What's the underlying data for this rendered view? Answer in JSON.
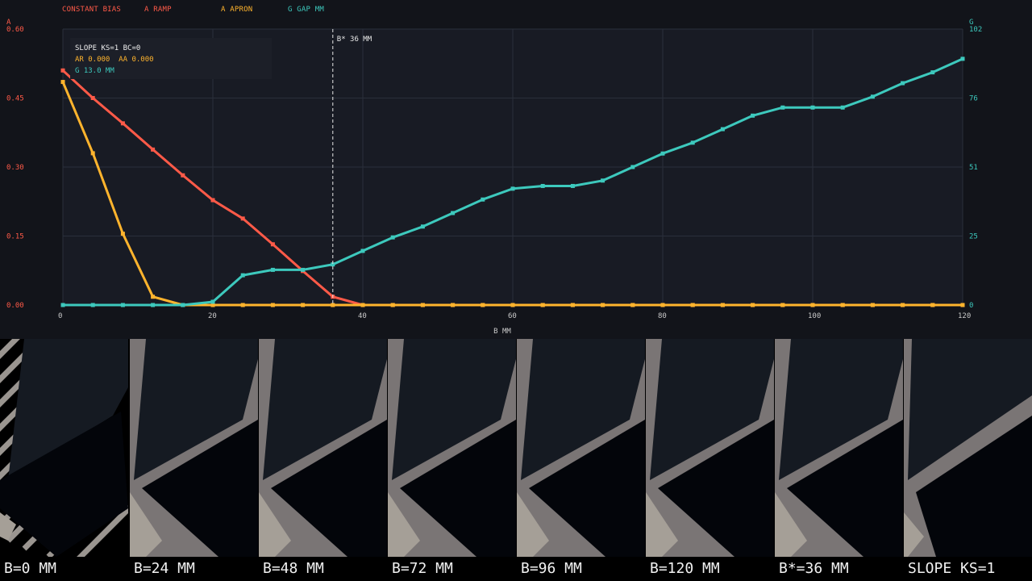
{
  "colors": {
    "background": "#12141a",
    "plot_background": "#181b24",
    "grid": "#2a2f3b",
    "constant_bias": "#ff5a48",
    "ramp": "#ffb42d",
    "apron": "#ffb42d",
    "gap": "#3dc9bd",
    "axis_text": "#c9c9c9"
  },
  "legend": [
    {
      "label": "CONSTANT BIAS",
      "color": "#ff5a48"
    },
    {
      "label": "A RAMP",
      "color": "#ff5a48"
    },
    {
      "label": "A APRON",
      "color": "#ffb42d"
    },
    {
      "label": "G GAP MM",
      "color": "#3dc9bd"
    }
  ],
  "info": {
    "line1": "SLOPE KS=1 BC=0",
    "line2": "AR 0.000  AA 0.000",
    "line3": "G 13.0 MM"
  },
  "chart_data": {
    "type": "line",
    "xlabel": "B MM",
    "ylabel_left": "A",
    "ylabel_right": "G",
    "x_ticks": [
      0,
      20,
      40,
      60,
      80,
      100,
      120
    ],
    "xlim": [
      0,
      120
    ],
    "y_left_ticks": [
      "0.00",
      "0.15",
      "0.30",
      "0.45",
      "0.60"
    ],
    "y_left_lim": [
      0,
      0.6
    ],
    "y_right_ticks": [
      "0",
      "25",
      "51",
      "76",
      "102"
    ],
    "y_right_lim": [
      0,
      102
    ],
    "grid": true,
    "marker": {
      "x": 36,
      "label": "B* 36 MM"
    },
    "x": [
      0,
      4,
      8,
      12,
      16,
      20,
      24,
      28,
      32,
      36,
      40,
      44,
      48,
      52,
      56,
      60,
      64,
      68,
      72,
      76,
      80,
      84,
      88,
      92,
      96,
      100,
      104,
      108,
      112,
      116,
      120
    ],
    "series": [
      {
        "key": "ramp",
        "axis": "left",
        "color": "#ff5a48",
        "values": [
          0.51,
          0.45,
          0.395,
          0.338,
          0.282,
          0.228,
          0.188,
          0.132,
          0.074,
          0.018,
          0,
          0,
          0,
          0,
          0,
          0,
          0,
          0,
          0,
          0,
          0,
          0,
          0,
          0,
          0,
          0,
          0,
          0,
          0,
          0,
          0
        ]
      },
      {
        "key": "apron",
        "axis": "left",
        "color": "#ffb42d",
        "values": [
          0.485,
          0.33,
          0.155,
          0.018,
          0,
          0,
          0,
          0,
          0,
          0,
          0,
          0,
          0,
          0,
          0,
          0,
          0,
          0,
          0,
          0,
          0,
          0,
          0,
          0,
          0,
          0,
          0,
          0,
          0,
          0,
          0
        ]
      },
      {
        "key": "gap",
        "axis": "right",
        "color": "#3dc9bd",
        "values": [
          0,
          0,
          0,
          0,
          0,
          1.2,
          11,
          13,
          13,
          15,
          20,
          25,
          29,
          34,
          39,
          43,
          44,
          44,
          46,
          51,
          56,
          60,
          65,
          70,
          73,
          73,
          73,
          77,
          82,
          86,
          91
        ]
      }
    ]
  },
  "thumbnails": [
    {
      "label": "B=0 MM",
      "variant": "zero"
    },
    {
      "label": "B=24 MM",
      "variant": "normal"
    },
    {
      "label": "B=48 MM",
      "variant": "normal"
    },
    {
      "label": "B=72 MM",
      "variant": "normal"
    },
    {
      "label": "B=96 MM",
      "variant": "normal"
    },
    {
      "label": "B=120 MM",
      "variant": "normal"
    },
    {
      "label": "B*=36 MM",
      "variant": "normal"
    },
    {
      "label": "SLOPE KS=1",
      "variant": "slope"
    }
  ]
}
